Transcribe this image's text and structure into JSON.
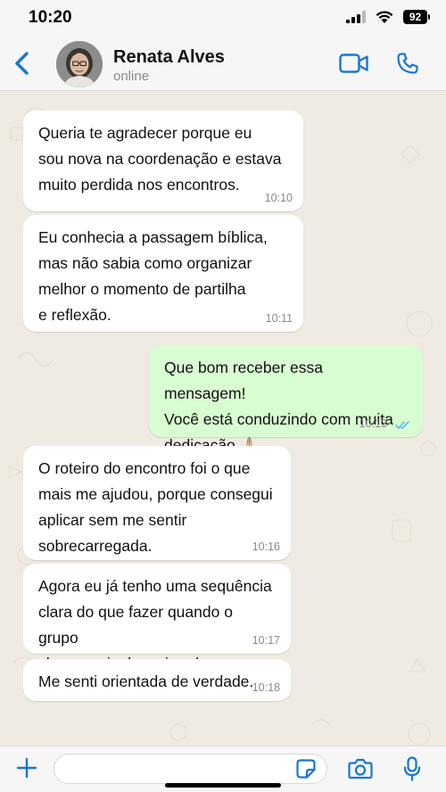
{
  "status_bar": {
    "time": "10:20",
    "battery": "92"
  },
  "header": {
    "contact_name": "Renata Alves",
    "contact_status": "online"
  },
  "messages": [
    {
      "direction": "in",
      "text": "Queria te agradecer porque eu\nsou nova na coordenação e estava\nmuito perdida nos encontros.",
      "time": "10:10"
    },
    {
      "direction": "in",
      "text": "Eu conhecia a passagem bíblica,\nmas não sabia como organizar\nmelhor o momento de partilha\ne reflexão.",
      "time": "10:11"
    },
    {
      "direction": "out",
      "text": "Que bom receber essa mensagem!\nVocê está conduzindo com muita\ndedicação 🙏🏼",
      "time": "10:13",
      "status": "read"
    },
    {
      "direction": "in",
      "text": "O roteiro do encontro foi o que\nmais me ajudou, porque consegui\naplicar sem me sentir\nsobrecarregada.",
      "time": "10:16"
    },
    {
      "direction": "in",
      "text": "Agora eu já tenho uma sequência\nclara do que fazer quando o grupo\nchega mais desanimado.",
      "time": "10:17"
    },
    {
      "direction": "in",
      "text": "Me senti orientada de verdade.",
      "time": "10:18"
    }
  ],
  "input": {
    "placeholder": "",
    "value": ""
  },
  "icons": {
    "back": "chevron-left-icon",
    "video": "video-camera-icon",
    "call": "phone-icon",
    "plus": "plus-icon",
    "sticker": "sticker-icon",
    "camera": "camera-icon",
    "mic": "microphone-icon",
    "read_receipt": "double-check-icon"
  },
  "colors": {
    "accent": "#1877d2",
    "incoming_bubble": "#ffffff",
    "outgoing_bubble": "#d9fdd3",
    "chat_background": "#efeae2",
    "read_ticks": "#53bdeb"
  }
}
